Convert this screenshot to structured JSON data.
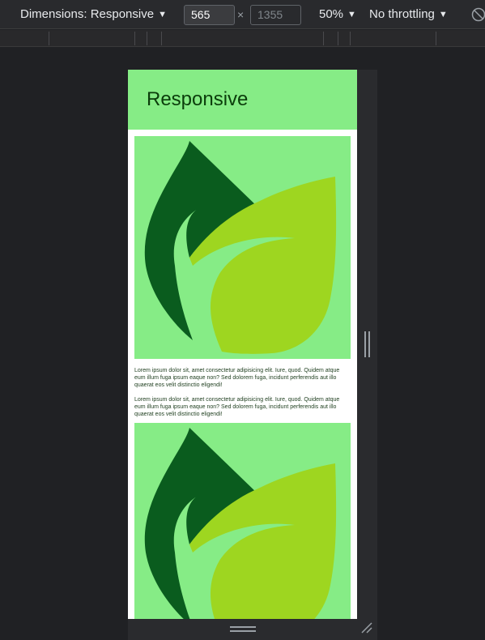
{
  "toolbar": {
    "dimensions_label": "Dimensions: Responsive",
    "width_value": "565",
    "height_placeholder": "1355",
    "times_symbol": "×",
    "zoom_label": "50%",
    "throttle_label": "No throttling",
    "caret": "▼"
  },
  "page": {
    "title": "Responsive",
    "paragraphs": [
      "Lorem ipsum dolor sit, amet consectetur adipisicing elit. Iure, quod. Quidem atque eum illum fuga ipsum eaque non? Sed dolorem fuga, incidunt perferendis aut illo quaerat eos velit distinctio eligendi!",
      "Lorem ipsum dolor sit, amet consectetur adipisicing elit. Iure, quod. Quidem atque eum illum fuga ipsum eaque non? Sed dolorem fuga, incidunt perferendis aut illo quaerat eos velit distinctio eligendi!"
    ],
    "header_color": "#86ec86",
    "dark_leaf_color": "#0a5c1e",
    "light_leaf_color": "#9ed620"
  },
  "icons": {
    "rotate": "rotate-icon",
    "leaf": "leaf-logo-icon"
  }
}
